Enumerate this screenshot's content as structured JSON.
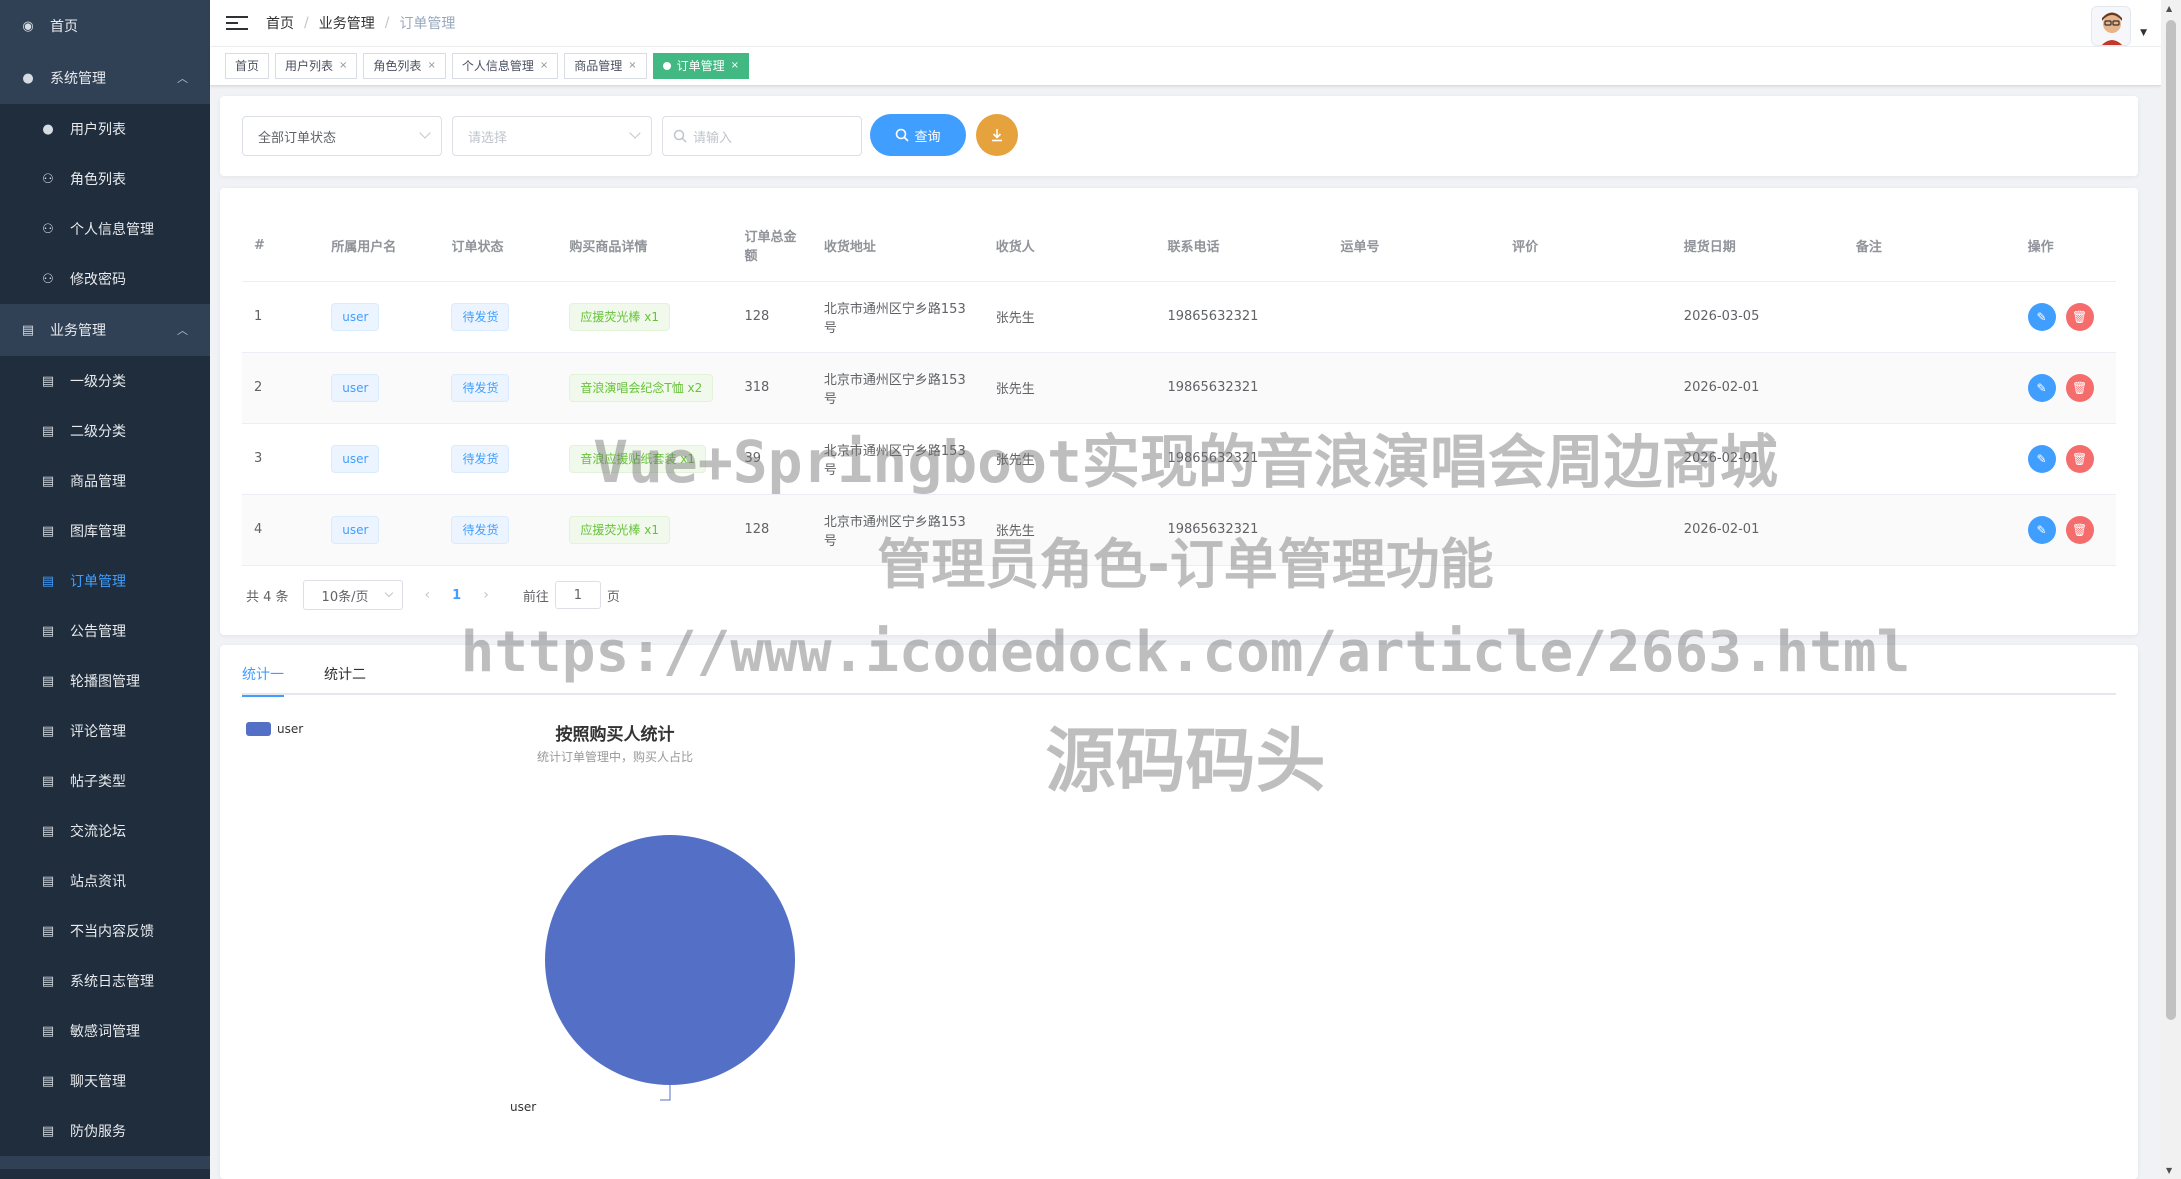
{
  "sidebar": {
    "items": [
      {
        "label": "首页",
        "icon": "dashboard-icon",
        "level": "top"
      },
      {
        "label": "系统管理",
        "icon": "user-icon",
        "level": "top",
        "expanded": true
      },
      {
        "label": "用户列表",
        "icon": "user-icon",
        "level": "sub"
      },
      {
        "label": "角色列表",
        "icon": "peoples-icon",
        "level": "sub"
      },
      {
        "label": "个人信息管理",
        "icon": "peoples-icon",
        "level": "sub"
      },
      {
        "label": "修改密码",
        "icon": "peoples-icon",
        "level": "sub"
      },
      {
        "label": "业务管理",
        "icon": "document-icon",
        "level": "top",
        "expanded": true
      },
      {
        "label": "一级分类",
        "icon": "document-icon",
        "level": "sub"
      },
      {
        "label": "二级分类",
        "icon": "document-icon",
        "level": "sub"
      },
      {
        "label": "商品管理",
        "icon": "document-icon",
        "level": "sub"
      },
      {
        "label": "图库管理",
        "icon": "document-icon",
        "level": "sub"
      },
      {
        "label": "订单管理",
        "icon": "document-icon",
        "level": "sub",
        "active": true
      },
      {
        "label": "公告管理",
        "icon": "document-icon",
        "level": "sub"
      },
      {
        "label": "轮播图管理",
        "icon": "document-icon",
        "level": "sub"
      },
      {
        "label": "评论管理",
        "icon": "document-icon",
        "level": "sub"
      },
      {
        "label": "帖子类型",
        "icon": "document-icon",
        "level": "sub"
      },
      {
        "label": "交流论坛",
        "icon": "document-icon",
        "level": "sub"
      },
      {
        "label": "站点资讯",
        "icon": "document-icon",
        "level": "sub"
      },
      {
        "label": "不当内容反馈",
        "icon": "document-icon",
        "level": "sub"
      },
      {
        "label": "系统日志管理",
        "icon": "document-icon",
        "level": "sub"
      },
      {
        "label": "敏感词管理",
        "icon": "document-icon",
        "level": "sub"
      },
      {
        "label": "聊天管理",
        "icon": "document-icon",
        "level": "sub"
      },
      {
        "label": "防伪服务",
        "icon": "document-icon",
        "level": "sub"
      }
    ]
  },
  "header": {
    "breadcrumb": [
      "首页",
      "业务管理",
      "订单管理"
    ]
  },
  "tags": [
    {
      "label": "首页",
      "closable": false,
      "active": false
    },
    {
      "label": "用户列表",
      "closable": true,
      "active": false
    },
    {
      "label": "角色列表",
      "closable": true,
      "active": false
    },
    {
      "label": "个人信息管理",
      "closable": true,
      "active": false
    },
    {
      "label": "商品管理",
      "closable": true,
      "active": false
    },
    {
      "label": "订单管理",
      "closable": true,
      "active": true
    }
  ],
  "filters": {
    "status_select": "全部订单状态",
    "second_select_placeholder": "请选择",
    "search_placeholder": "请输入",
    "query_button": "查询"
  },
  "table": {
    "columns": [
      "#",
      "所属用户名",
      "订单状态",
      "购买商品详情",
      "订单总金额",
      "收货地址",
      "收货人",
      "联系电话",
      "运单号",
      "评价",
      "提货日期",
      "备注",
      "操作"
    ],
    "rows": [
      {
        "no": "1",
        "user": "user",
        "status": "待发货",
        "goods": "应援荧光棒 x1",
        "amount": "128",
        "address": "北京市通州区宁乡路153号",
        "receiver": "张先生",
        "phone": "19865632321",
        "waybill": "",
        "review": "",
        "date": "2026-03-05",
        "remark": ""
      },
      {
        "no": "2",
        "user": "user",
        "status": "待发货",
        "goods": "音浪演唱会纪念T恤 x2",
        "amount": "318",
        "address": "北京市通州区宁乡路153号",
        "receiver": "张先生",
        "phone": "19865632321",
        "waybill": "",
        "review": "",
        "date": "2026-02-01",
        "remark": ""
      },
      {
        "no": "3",
        "user": "user",
        "status": "待发货",
        "goods": "音浪应援贴纸套装 x1",
        "amount": "39",
        "address": "北京市通州区宁乡路153号",
        "receiver": "张先生",
        "phone": "19865632321",
        "waybill": "",
        "review": "",
        "date": "2026-02-01",
        "remark": ""
      },
      {
        "no": "4",
        "user": "user",
        "status": "待发货",
        "goods": "应援荧光棒 x1",
        "amount": "128",
        "address": "北京市通州区宁乡路153号",
        "receiver": "张先生",
        "phone": "19865632321",
        "waybill": "",
        "review": "",
        "date": "2026-02-01",
        "remark": ""
      }
    ]
  },
  "pagination": {
    "total": "共 4 条",
    "page_size": "10条/页",
    "current_page": "1",
    "goto_prefix": "前往",
    "goto_value": "1",
    "goto_suffix": "页"
  },
  "stats": {
    "tabs": [
      "统计一",
      "统计二"
    ],
    "active_tab": 0
  },
  "chart_data": {
    "type": "pie",
    "title": "按照购买人统计",
    "subtitle": "统计订单管理中，购买人占比",
    "legend_position": "top-left",
    "categories": [
      "user"
    ],
    "values": [
      4
    ],
    "colors": [
      "#5470c6"
    ]
  },
  "watermark": {
    "line1": "Vue+Springboot实现的音浪演唱会周边商城",
    "line2": "管理员角色-订单管理功能",
    "line3": "https://www.icodedock.com/article/2663.html",
    "line4": "源码码头"
  },
  "colors": {
    "sidebar_bg": "#304156",
    "primary": "#409eff",
    "success_tag": "#42b983",
    "download": "#e6a23c",
    "danger": "#f56c6c"
  }
}
